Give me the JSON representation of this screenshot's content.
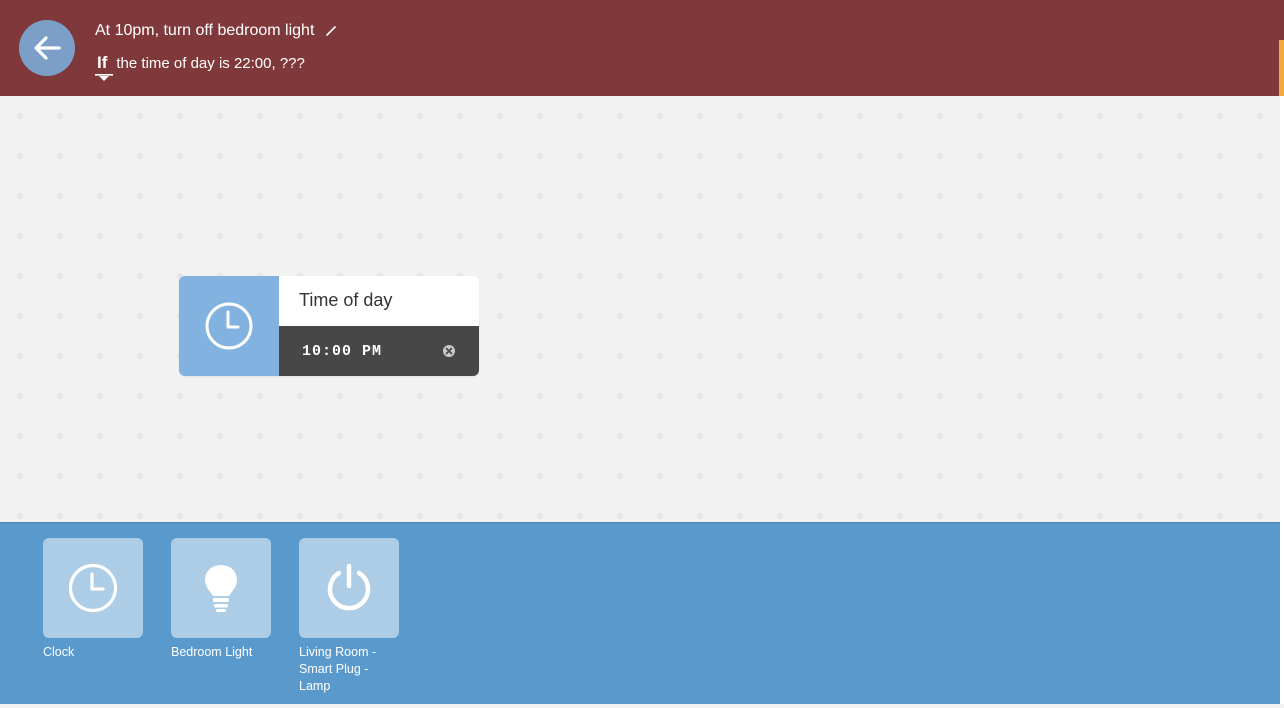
{
  "header": {
    "title": "At 10pm, turn off bedroom light",
    "condition_keyword": "If",
    "condition_text": "the time of day is 22:00, ???",
    "background_color": "#80393b"
  },
  "node": {
    "title": "Time of day",
    "time_value": "10:00 PM",
    "icon": "clock-icon",
    "icon_color": "#82b3e0"
  },
  "palette": {
    "background_color": "#5999cc",
    "devices": [
      {
        "label": "Clock",
        "icon": "clock-icon"
      },
      {
        "label": "Bedroom Light",
        "icon": "lightbulb-icon"
      },
      {
        "label": "Living Room - Smart Plug - Lamp",
        "icon": "power-icon"
      }
    ]
  }
}
